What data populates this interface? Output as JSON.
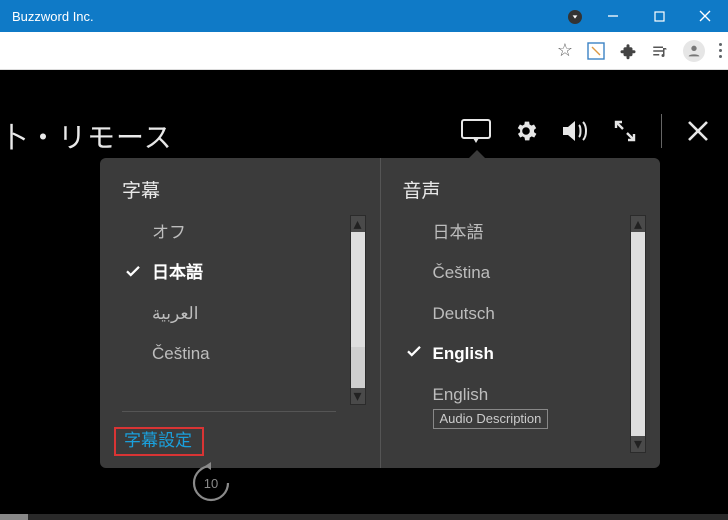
{
  "window": {
    "title": "Buzzword Inc."
  },
  "video": {
    "title": "卜・リモース"
  },
  "subtitle_panel": {
    "heading": "字幕",
    "items": [
      {
        "label": "オフ",
        "selected": false
      },
      {
        "label": "日本語",
        "selected": true
      },
      {
        "label": "العربية",
        "selected": false
      },
      {
        "label": "Čeština",
        "selected": false
      }
    ],
    "settings_label": "字幕設定"
  },
  "audio_panel": {
    "heading": "音声",
    "items": [
      {
        "label": "日本語",
        "selected": false
      },
      {
        "label": "Čeština",
        "selected": false
      },
      {
        "label": "Deutsch",
        "selected": false
      },
      {
        "label": "English",
        "selected": true
      },
      {
        "label": "English",
        "badge": "Audio Description",
        "selected": false
      }
    ]
  },
  "rewind_seconds": "10"
}
